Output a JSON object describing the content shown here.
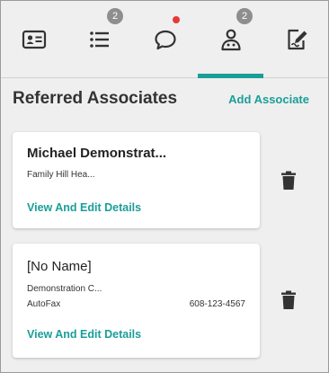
{
  "tabs": [
    {
      "icon": "contact-card-icon"
    },
    {
      "icon": "list-icon",
      "badge": "2"
    },
    {
      "icon": "chat-bubble-icon",
      "notification": true
    },
    {
      "icon": "associates-icon",
      "badge": "2",
      "active": true
    },
    {
      "icon": "edit-document-icon"
    }
  ],
  "header": {
    "title": "Referred Associates",
    "add_label": "Add Associate"
  },
  "associates": [
    {
      "name": "Michael Demonstrat...",
      "organization": "Family Hill Hea...",
      "type": "",
      "phone": "",
      "link_label": "View And Edit Details"
    },
    {
      "name": "[No Name]",
      "organization": "Demonstration C...",
      "type": "AutoFax",
      "phone": "608-123-4567",
      "link_label": "View And Edit Details"
    }
  ],
  "colors": {
    "accent": "#1a9e98",
    "badge": "#8e8e8e",
    "notification": "#e53935"
  }
}
